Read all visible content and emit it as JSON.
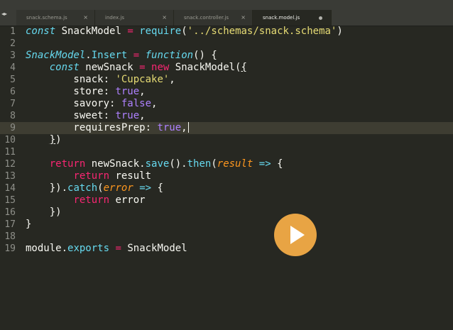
{
  "tabs": [
    {
      "label": "snack.schema.js",
      "close": "×"
    },
    {
      "label": "index.js",
      "close": "×"
    },
    {
      "label": "snack.controller.js",
      "close": "×"
    },
    {
      "label": "snack.model.js",
      "close": ""
    }
  ],
  "nav": {
    "arrows": "◂▸"
  },
  "editor": {
    "line_numbers": [
      "1",
      "2",
      "3",
      "4",
      "5",
      "6",
      "7",
      "8",
      "9",
      "10",
      "11",
      "12",
      "13",
      "14",
      "15",
      "16",
      "17",
      "18",
      "19"
    ],
    "current_line": "9",
    "tokens": {
      "l1_const": "const",
      "l1_rest": " SnackModel ",
      "l1_eq": "=",
      "l1_require": "require",
      "l1_open": "(",
      "l1_str": "'../schemas/snack.schema'",
      "l1_close": ")",
      "l3_cls": "SnackModel",
      "l3_dot": ".",
      "l3_insert": "Insert",
      "l3_sp": " ",
      "l3_eq": "=",
      "l3_sp2": " ",
      "l3_function": "function",
      "l3_rest": "() {",
      "l4_indent": "    ",
      "l4_const": "const",
      "l4_name": " newSnack ",
      "l4_eq": "=",
      "l4_sp": " ",
      "l4_new": "new",
      "l4_cls": " SnackModel(",
      "l4_brace": "{",
      "l5_key": "        snack: ",
      "l5_str": "'Cupcake'",
      "l5_comma": ",",
      "l6_key": "        store: ",
      "l6_val": "true",
      "l6_comma": ",",
      "l7_key": "        savory: ",
      "l7_val": "false",
      "l7_comma": ",",
      "l8_key": "        sweet: ",
      "l8_val": "true",
      "l8_comma": ",",
      "l9_key": "        requiresPrep: ",
      "l9_val": "true",
      "l9_comma": ",",
      "l10_indent": "    ",
      "l10_brace": "}",
      "l10_paren": ")",
      "l12_indent": "    ",
      "l12_return": "return",
      "l12_name": " newSnack.",
      "l12_save": "save",
      "l12_mid": "().",
      "l12_then": "then",
      "l12_open": "(",
      "l12_param": "result",
      "l12_sp": " ",
      "l12_arrow": "=>",
      "l12_brace": " {",
      "l13_indent": "        ",
      "l13_return": "return",
      "l13_rest": " result",
      "l14_start": "    }).",
      "l14_catch": "catch",
      "l14_open": "(",
      "l14_param": "error",
      "l14_sp": " ",
      "l14_arrow": "=>",
      "l14_brace": " {",
      "l15_indent": "        ",
      "l15_return": "return",
      "l15_rest": " error",
      "l16_rest": "    })",
      "l17_rest": "}",
      "l19_module": "module",
      "l19_dot": ".",
      "l19_exports": "exports",
      "l19_sp": " ",
      "l19_eq": "=",
      "l19_rest": " SnackModel"
    }
  },
  "colors": {
    "background": "#272822",
    "play_button": "#e8a444",
    "keyword": "#66d9ef",
    "reserved": "#f92672",
    "string": "#e6db74",
    "boolean": "#ae81ff",
    "parameter": "#fd971f"
  },
  "icons": {
    "play": "play-icon"
  }
}
